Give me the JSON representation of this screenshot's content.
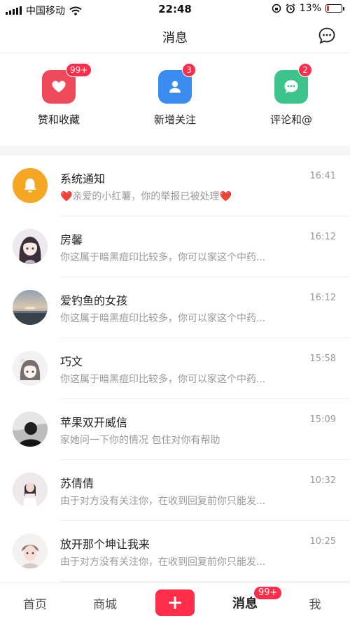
{
  "status_bar": {
    "carrier": "中国移动",
    "time": "22:48",
    "battery_percent": "13%",
    "battery_level": 0.13,
    "icons": [
      "signal-icon",
      "wifi-icon",
      "screen-lock-icon",
      "alarm-icon",
      "battery-icon"
    ]
  },
  "header": {
    "title": "消息",
    "chat_icon": "new-chat-icon"
  },
  "categories": [
    {
      "label": "赞和收藏",
      "badge": "99+",
      "icon": "heart-icon",
      "color": "#f0495a"
    },
    {
      "label": "新增关注",
      "badge": "3",
      "icon": "person-icon",
      "color": "#3b8cf0"
    },
    {
      "label": "评论和@",
      "badge": "2",
      "icon": "comment-icon",
      "color": "#3cc48c"
    }
  ],
  "messages": [
    {
      "name": "系统通知",
      "preview": "亲爱的小红薯，你的举报已被处理",
      "time": "16:41",
      "avatar": "bell-icon"
    },
    {
      "name": "房馨",
      "preview": "你这属于暗黑痘印比较多，你可以家这个中药...",
      "time": "16:12",
      "avatar": "user-avatar"
    },
    {
      "name": "爱钓鱼的女孩",
      "preview": "你这属于暗黑痘印比较多，你可以家这个中药...",
      "time": "16:12",
      "avatar": "user-avatar"
    },
    {
      "name": "巧文",
      "preview": "你这属于暗黑痘印比较多，你可以家这个中药...",
      "time": "15:58",
      "avatar": "user-avatar"
    },
    {
      "name": "苹果双开威信",
      "preview": "家她问一下你的情况 包住对你有帮助",
      "time": "15:09",
      "avatar": "user-avatar"
    },
    {
      "name": "苏倩倩",
      "preview": "由于对方没有关注你，在收到回复前你只能发...",
      "time": "10:32",
      "avatar": "user-avatar"
    },
    {
      "name": "放开那个坤让我来",
      "preview": "由于对方没有关注你，在收到回复前你只能发...",
      "time": "10:25",
      "avatar": "user-avatar"
    }
  ],
  "tab_bar": {
    "home": "首页",
    "mall": "商城",
    "post_icon": "plus-icon",
    "messages": "消息",
    "messages_badge": "99+",
    "me": "我"
  },
  "colors": {
    "accent": "#ff2d4a",
    "system_avatar": "#f5a623"
  }
}
